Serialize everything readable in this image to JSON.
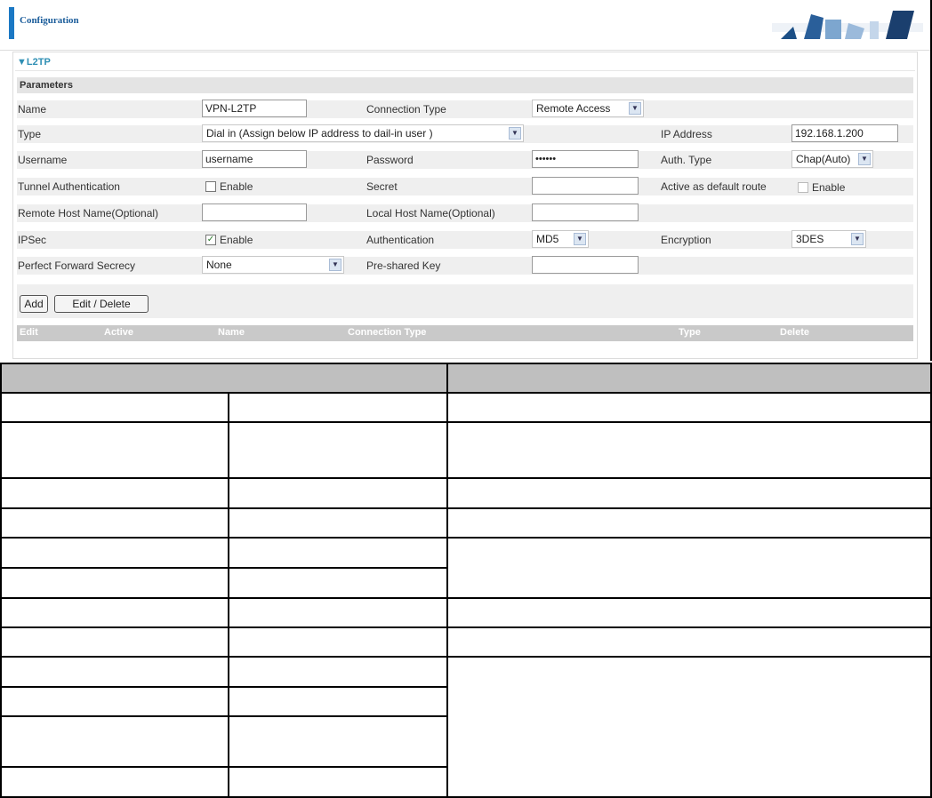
{
  "header": {
    "title": "Configuration"
  },
  "section": {
    "title": "▼L2TP",
    "parameters": "Parameters"
  },
  "fields": {
    "name": {
      "label": "Name",
      "value": "VPN-L2TP"
    },
    "connection_type": {
      "label": "Connection Type",
      "value": "Remote Access"
    },
    "type": {
      "label": "Type",
      "value": "Dial in (Assign below IP address to dail-in user )"
    },
    "ip_address": {
      "label": "IP Address",
      "value": "192.168.1.200"
    },
    "username": {
      "label": "Username",
      "value": "username"
    },
    "password": {
      "label": "Password",
      "value": "••••••"
    },
    "auth_type": {
      "label": "Auth. Type",
      "value": "Chap(Auto)"
    },
    "tunnel_auth": {
      "label": "Tunnel Authentication",
      "check_label": "Enable",
      "checked": false
    },
    "secret": {
      "label": "Secret",
      "value": ""
    },
    "default_route": {
      "label": "Active as default route",
      "check_label": "Enable",
      "checked": false
    },
    "remote_host": {
      "label": "Remote Host Name(Optional)",
      "value": ""
    },
    "local_host": {
      "label": "Local Host Name(Optional)",
      "value": ""
    },
    "ipsec": {
      "label": "IPSec",
      "check_label": "Enable",
      "checked": true
    },
    "authentication": {
      "label": "Authentication",
      "value": "MD5"
    },
    "encryption": {
      "label": "Encryption",
      "value": "3DES"
    },
    "pfs": {
      "label": "Perfect Forward Secrecy",
      "value": "None"
    },
    "psk": {
      "label": "Pre-shared Key",
      "value": ""
    }
  },
  "buttons": {
    "add": "Add",
    "edit_delete": "Edit / Delete"
  },
  "list_headers": [
    "Edit",
    "Active",
    "Name",
    "Connection Type",
    "Type",
    "Delete"
  ],
  "colors": {
    "accent": "#1b78c4",
    "section_title": "#2f8fb4",
    "row_bg": "#efefef",
    "header_bg": "#c9c9c9"
  }
}
